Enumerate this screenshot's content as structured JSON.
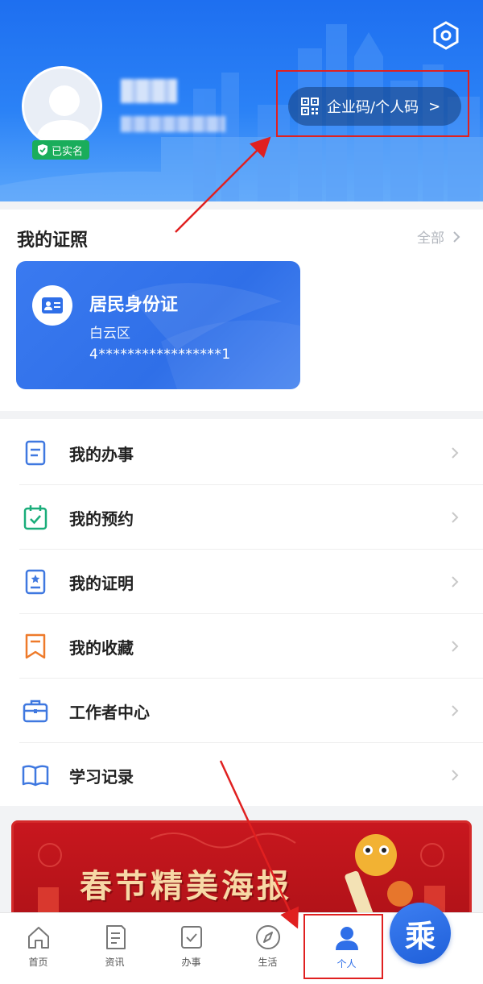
{
  "header": {
    "verified_label": "已实名",
    "code_button_label": "企业码/个人码",
    "chevron": ">"
  },
  "licences": {
    "section_title": "我的证照",
    "view_all_label": "全部",
    "card": {
      "title": "居民身份证",
      "district": "白云区",
      "number": "4*****************1"
    }
  },
  "menu": {
    "items": [
      {
        "label": "我的办事",
        "icon": "document-icon"
      },
      {
        "label": "我的预约",
        "icon": "calendar-check-icon"
      },
      {
        "label": "我的证明",
        "icon": "certificate-icon"
      },
      {
        "label": "我的收藏",
        "icon": "bookmark-icon"
      },
      {
        "label": "工作者中心",
        "icon": "briefcase-icon"
      },
      {
        "label": "学习记录",
        "icon": "book-icon"
      }
    ]
  },
  "banner": {
    "title": "春节精美海报"
  },
  "tabbar": {
    "tabs": [
      {
        "label": "首页",
        "icon": "home-icon"
      },
      {
        "label": "资讯",
        "icon": "news-icon"
      },
      {
        "label": "办事",
        "icon": "task-check-icon"
      },
      {
        "label": "生活",
        "icon": "compass-icon"
      },
      {
        "label": "个人",
        "icon": "person-icon",
        "active": true
      }
    ],
    "fab_glyph": "乘"
  },
  "colors": {
    "brand_blue": "#2f6fe8",
    "verified_green": "#1aad5b",
    "annotation_red": "#e02020",
    "banner_red": "#c8171e"
  }
}
